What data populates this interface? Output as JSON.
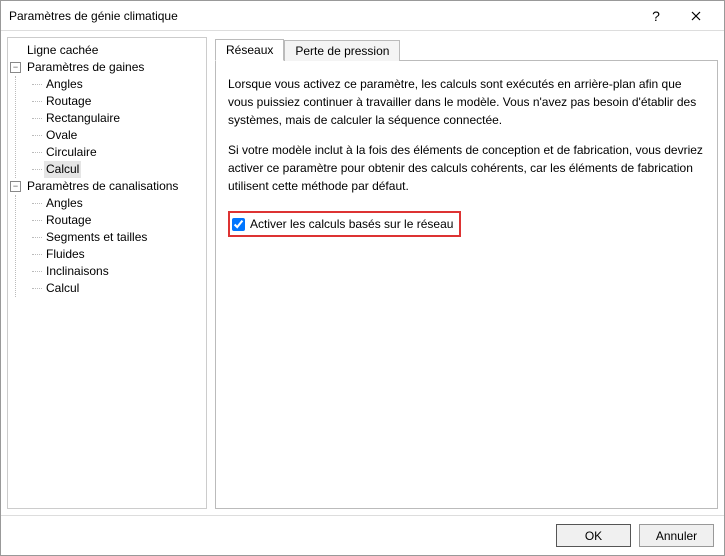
{
  "window": {
    "title": "Paramètres de génie climatique"
  },
  "tree": {
    "items": [
      {
        "label": "Ligne cachée"
      },
      {
        "label": "Paramètres de gaines",
        "children": [
          "Angles",
          "Routage",
          "Rectangulaire",
          "Ovale",
          "Circulaire",
          "Calcul"
        ],
        "selectedChild": 5
      },
      {
        "label": "Paramètres de canalisations",
        "children": [
          "Angles",
          "Routage",
          "Segments et tailles",
          "Fluides",
          "Inclinaisons",
          "Calcul"
        ]
      }
    ]
  },
  "tabs": {
    "items": [
      "Réseaux",
      "Perte de pression"
    ],
    "active": 0
  },
  "panel": {
    "para1": "Lorsque vous activez ce paramètre, les calculs sont exécutés en arrière-plan afin que vous puissiez continuer à travailler dans le modèle. Vous n'avez pas besoin d'établir des systèmes, mais de calculer la séquence connectée.",
    "para2": "Si votre modèle inclut à la fois des éléments de conception et de fabrication, vous devriez activer ce paramètre pour obtenir des calculs cohérents, car les éléments de fabrication utilisent cette méthode par défaut.",
    "checkbox_label": "Activer les calculs basés sur le réseau"
  },
  "footer": {
    "ok": "OK",
    "cancel": "Annuler"
  }
}
